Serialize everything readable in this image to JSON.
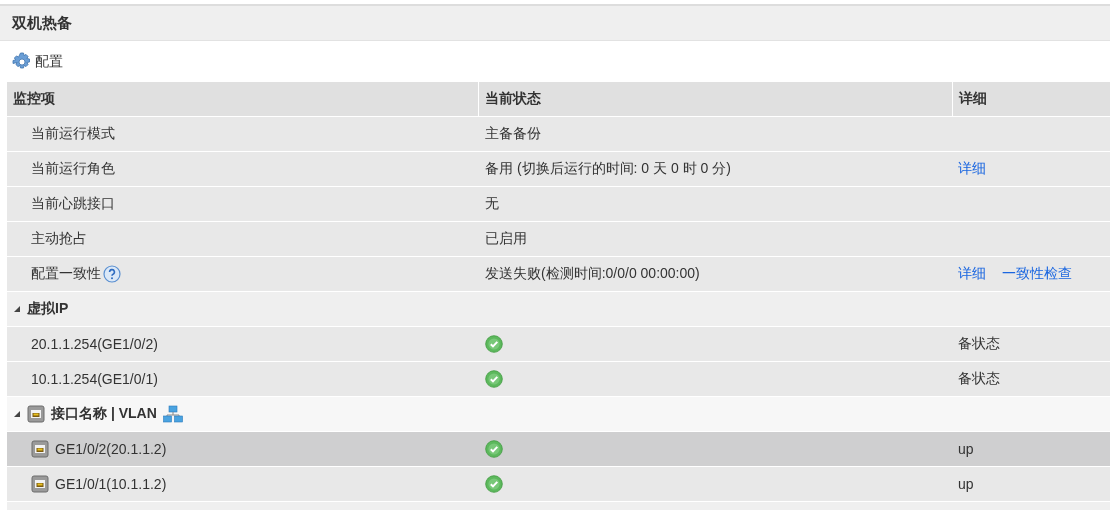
{
  "panel": {
    "title": "双机热备"
  },
  "toolbar": {
    "config_label": "配置"
  },
  "table": {
    "columns": [
      "监控项",
      "当前状态",
      "详细"
    ],
    "rows": [
      {
        "kind": "item",
        "item": "当前运行模式",
        "status": "主备备份"
      },
      {
        "kind": "item",
        "item": "当前运行角色",
        "status": "备用 (切换后运行的时间: 0 天 0 时 0 分)",
        "links": [
          "详细"
        ]
      },
      {
        "kind": "item",
        "item": "当前心跳接口",
        "status": "无"
      },
      {
        "kind": "item",
        "item": "主动抢占",
        "status": "已启用"
      },
      {
        "kind": "help-item",
        "item": "配置一致性",
        "status": "发送失败(检测时间:0/0/0 00:00:00)",
        "links": [
          "详细",
          "一致性检查"
        ]
      },
      {
        "kind": "ip-group",
        "label": "虚拟IP",
        "expanded": true
      },
      {
        "kind": "ok-item",
        "item": "20.1.1.254(GE1/0/2)",
        "detail": "备状态"
      },
      {
        "kind": "ok-item",
        "item": "10.1.1.254(GE1/0/1)",
        "detail": "备状态"
      },
      {
        "kind": "interface-group",
        "label": "接口名称 | VLAN",
        "expanded": true
      },
      {
        "kind": "interface",
        "item": "GE1/0/2(20.1.1.2)",
        "detail": "up",
        "selected": true
      },
      {
        "kind": "interface",
        "item": "GE1/0/1(10.1.1.2)",
        "detail": "up",
        "selected": false
      },
      {
        "kind": "cut-row"
      }
    ]
  }
}
